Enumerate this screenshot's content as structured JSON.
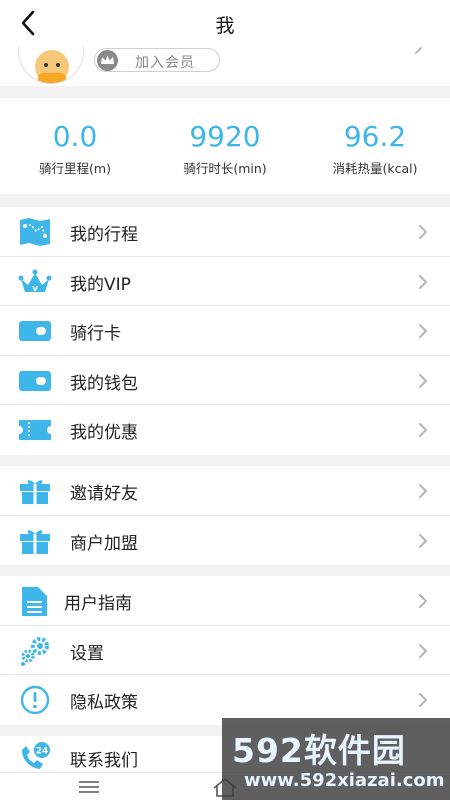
{
  "header": {
    "title": "我"
  },
  "profile": {
    "vip_button_label": "加入会员"
  },
  "stats": [
    {
      "value": "0.0",
      "label": "骑行里程(m)"
    },
    {
      "value": "9920",
      "label": "骑行时长(min)"
    },
    {
      "value": "96.2",
      "label": "消耗热量(kcal)"
    }
  ],
  "menu_group_1": [
    {
      "label": "我的行程",
      "icon": "map-route-icon"
    },
    {
      "label": "我的VIP",
      "icon": "crown-icon"
    },
    {
      "label": "骑行卡",
      "icon": "card-icon"
    },
    {
      "label": "我的钱包",
      "icon": "wallet-icon"
    },
    {
      "label": "我的优惠",
      "icon": "coupon-icon"
    }
  ],
  "menu_group_2": [
    {
      "label": "邀请好友",
      "icon": "gift-icon"
    },
    {
      "label": "商户加盟",
      "icon": "gift-icon"
    }
  ],
  "menu_group_3": [
    {
      "label": "用户指南",
      "icon": "document-icon"
    },
    {
      "label": "设置",
      "icon": "gear-icon"
    },
    {
      "label": "隐私政策",
      "icon": "info-icon"
    }
  ],
  "menu_group_4": [
    {
      "label": "联系我们",
      "icon": "phone-24-icon",
      "badge": "24"
    }
  ],
  "watermark": {
    "brand": "592软件园",
    "url": "www.592xiazai.com"
  },
  "colors": {
    "accent": "#3fb6ea",
    "background": "#f2f2f2"
  }
}
